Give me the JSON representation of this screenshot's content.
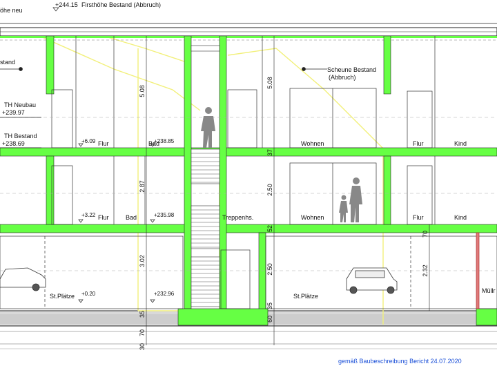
{
  "colors": {
    "structure_green": "#66ff44",
    "demolition_yellow": "#f2f07a",
    "line": "#222222",
    "ground": "#cfcfcf",
    "footer_blue": "#1a4fd8",
    "red_accent": "#e07a7a"
  },
  "levels": {
    "ridge_old": "+244.15",
    "ridge_old_label": "Firsthöhe Bestand (Abbruch)",
    "ridge_new_label_fragment": "öhe neu",
    "barn_label_fragment": "stand",
    "th_neubau_label": "TH Neubau",
    "th_neubau_value": "+239.97",
    "th_bestand_label": "TH Bestand",
    "th_bestand_value": "+238.69",
    "scheune_label_line1": "Scheune Bestand",
    "scheune_label_line2": "(Abbruch)",
    "floor2_left": "+6.09",
    "floor2_mid": "+238.85",
    "floor1_left": "+3.22",
    "floor1_mid": "+235.98",
    "ground_left": "+0.20",
    "ground_mid": "+232.96"
  },
  "rooms": {
    "f2_flur_left": "Flur",
    "f2_bad": "Bad",
    "f2_wohnen": "Wohnen",
    "f2_flur_right": "Flur",
    "f2_kind": "Kind",
    "f1_flur_left": "Flur",
    "f1_bad": "Bad",
    "f1_treppenhaus": "Treppenhs.",
    "f1_wohnen": "Wohnen",
    "f1_flur_right": "Flur",
    "f1_kind": "Kind",
    "g_stplaetze_left": "St.Plätze",
    "g_stplaetze_right": "St.Plätze",
    "g_muell": "Müllr"
  },
  "dimensions": {
    "left_f2_height": "5.08",
    "left_f1_height": "2.87",
    "left_g_height": "3.02",
    "left_slab_small": "35",
    "left_base_1": "70",
    "left_base_2": "30",
    "right_f2_height": "5.08",
    "right_slab_2": "37",
    "right_f1_height": "2.50",
    "right_slab_1": "52",
    "right_g_height": "2.50",
    "right_base_1": "35",
    "right_base_2": "60",
    "far_right_small": "70",
    "far_right_g": "2.32"
  },
  "footer_text": "gemäß Baubeschreibung Bericht 24.07.2020"
}
